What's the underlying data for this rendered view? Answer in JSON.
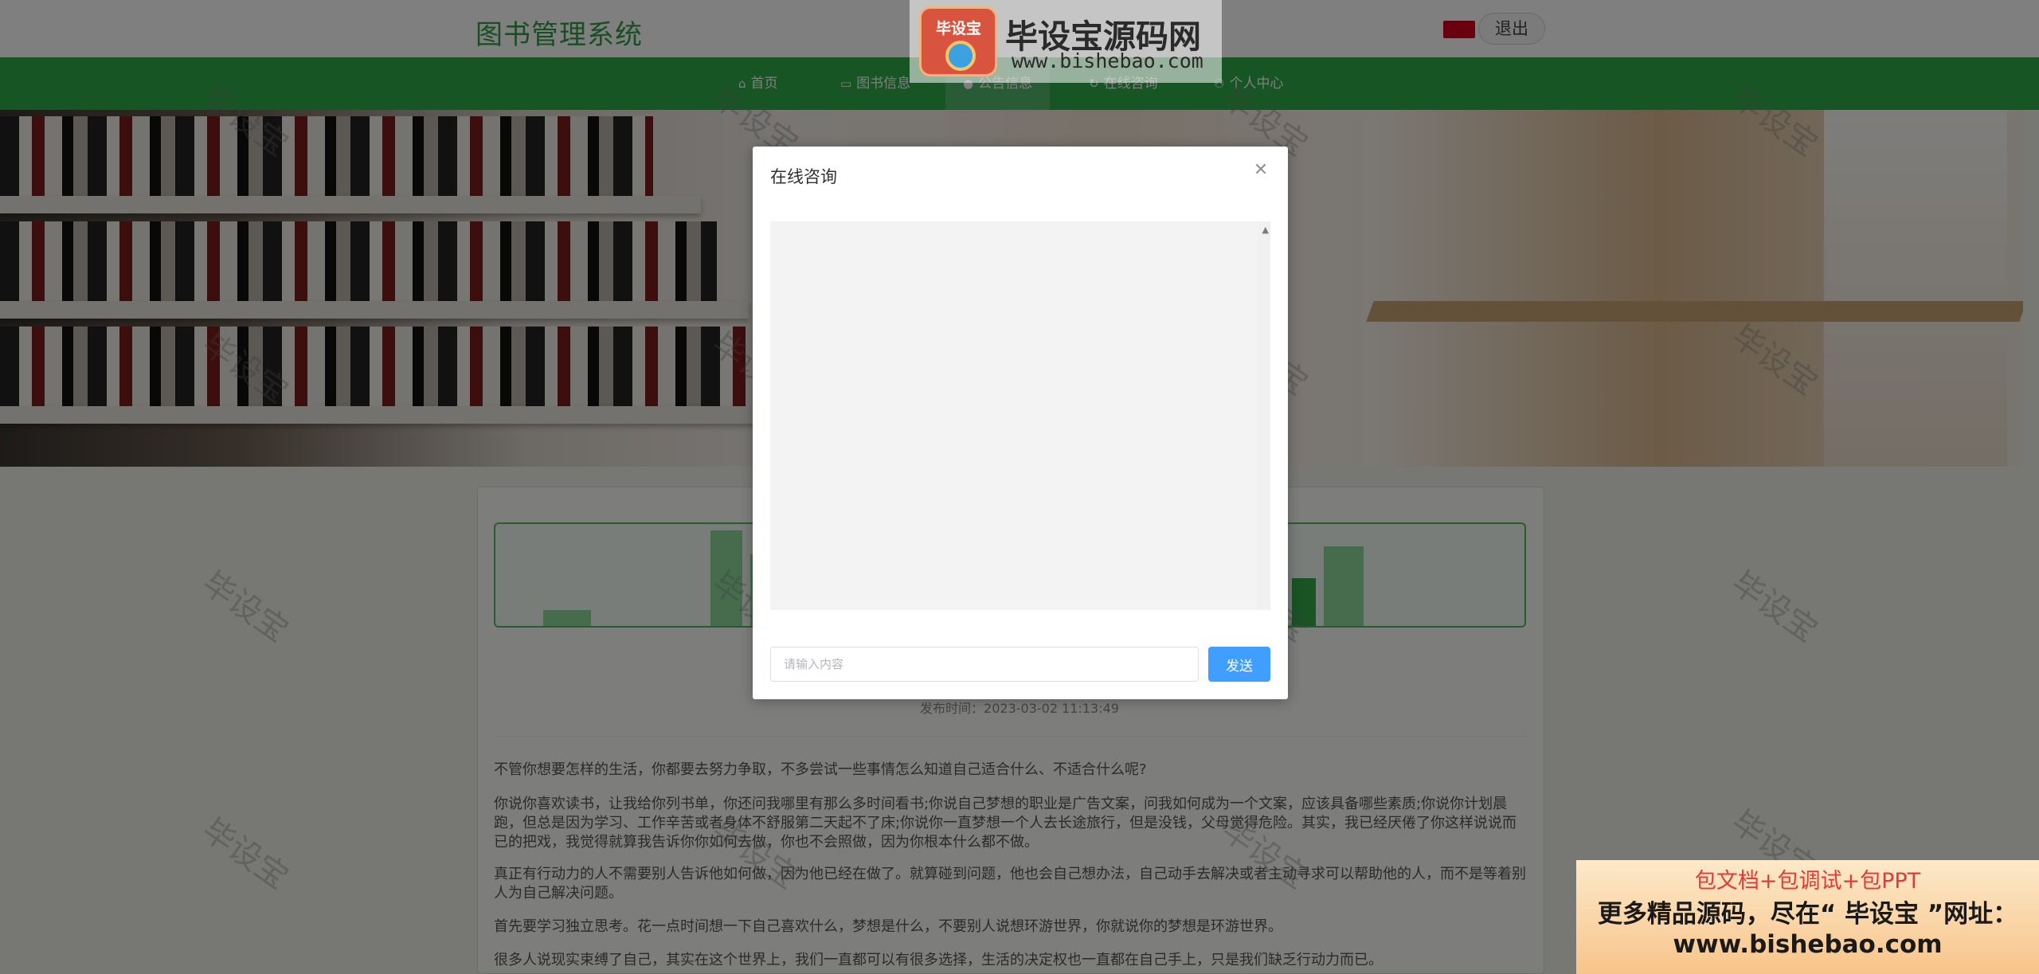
{
  "header": {
    "site_title": "图书管理系统",
    "logout_label": "退出"
  },
  "nav": {
    "items": [
      {
        "label": "首页",
        "icon": "home-icon"
      },
      {
        "label": "图书信息",
        "icon": "book-icon"
      },
      {
        "label": "公告信息",
        "icon": "notice-icon"
      },
      {
        "label": "在线咨询",
        "icon": "chat-icon"
      },
      {
        "label": "个人中心",
        "icon": "user-icon"
      }
    ],
    "active_index": 2
  },
  "article": {
    "publish_time": "发布时间：2023-03-02 11:13:49",
    "paragraphs": [
      "不管你想要怎样的生活，你都要去努力争取，不多尝试一些事情怎么知道自己适合什么、不适合什么呢?",
      "你说你喜欢读书，让我给你列书单，你还问我哪里有那么多时间看书;你说自己梦想的职业是广告文案，问我如何成为一个文案，应该具备哪些素质;你说你计划晨跑，但总是因为学习、工作辛苦或者身体不舒服第二天起不了床;你说你一直梦想一个人去长途旅行，但是没钱，父母觉得危险。其实，我已经厌倦了你这样说说而已的把戏，我觉得就算我告诉你你如何去做，你也不会照做，因为你根本什么都不做。",
      "真正有行动力的人不需要别人告诉他如何做，因为他已经在做了。就算碰到问题，他也会自己想办法，自己动手去解决或者主动寻求可以帮助他的人，而不是等着别人为自己解决问题。",
      "首先要学习独立思考。花一点时间想一下自己喜欢什么，梦想是什么，不要别人说想环游世界，你就说你的梦想是环游世界。",
      "很多人说现实束缚了自己，其实在这个世界上，我们一直都可以有很多选择，生活的决定权也一直都在自己手上，只是我们缺乏行动力而已。"
    ]
  },
  "dialog": {
    "title": "在线咨询",
    "close_icon": "close-icon",
    "input_placeholder": "请输入内容",
    "input_value": "",
    "send_label": "发送"
  },
  "watermark": {
    "text": "毕设宝"
  },
  "logo": {
    "seal_text": "毕设宝",
    "name": "毕设宝源码网",
    "url": "www.bishebao.com"
  },
  "ad": {
    "line1": "包文档+包调试+包PPT",
    "line2": "更多精品源码，尽在“ 毕设宝 ”网址：",
    "line3": "www.bishebao.com"
  },
  "colors": {
    "brand_green": "#2eaa4a",
    "send_blue": "#409eff",
    "title_green": "#2f9e44"
  }
}
